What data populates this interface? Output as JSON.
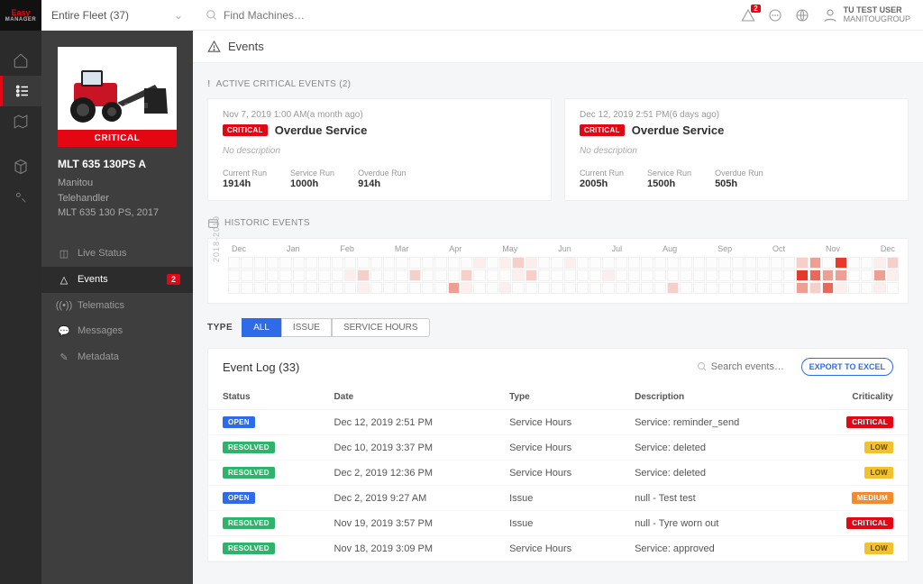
{
  "brand": {
    "name": "Easy",
    "sub": "MANAGER"
  },
  "fleet": {
    "label": "Entire Fleet (37)"
  },
  "topbar": {
    "search_placeholder": "Find Machines…",
    "alert_count": "2"
  },
  "user": {
    "name": "TU TEST USER",
    "org": "MANITOUGROUP"
  },
  "machine": {
    "critical": "CRITICAL",
    "title": "MLT 635 130PS A",
    "brand": "Manitou",
    "type": "Telehandler",
    "model": "MLT 635 130 PS, 2017"
  },
  "nav": {
    "live": "Live Status",
    "events": "Events",
    "events_badge": "2",
    "tele": "Telematics",
    "msg": "Messages",
    "meta": "Metadata"
  },
  "page": {
    "title": "Events",
    "active_label": "ACTIVE CRITICAL EVENTS (2)",
    "historic_label": "HISTORIC EVENTS"
  },
  "events": [
    {
      "time": "Nov 7, 2019 1:00 AM",
      "ago": "(a month ago)",
      "tag": "CRITICAL",
      "title": "Overdue Service",
      "desc": "No description",
      "stats": [
        {
          "l": "Current Run",
          "v": "1914h"
        },
        {
          "l": "Service Run",
          "v": "1000h"
        },
        {
          "l": "Overdue Run",
          "v": "914h"
        }
      ]
    },
    {
      "time": "Dec 12, 2019 2:51 PM",
      "ago": "(6 days ago)",
      "tag": "CRITICAL",
      "title": "Overdue Service",
      "desc": "No description",
      "stats": [
        {
          "l": "Current Run",
          "v": "2005h"
        },
        {
          "l": "Service Run",
          "v": "1500h"
        },
        {
          "l": "Overdue Run",
          "v": "505h"
        }
      ]
    }
  ],
  "months": [
    "Dec",
    "Jan",
    "Feb",
    "Mar",
    "Apr",
    "May",
    "Jun",
    "Jul",
    "Aug",
    "Sep",
    "Oct",
    "Nov",
    "Dec"
  ],
  "ylabel": "2018-2019",
  "tabs": {
    "label": "TYPE",
    "all": "ALL",
    "issue": "ISSUE",
    "sh": "SERVICE HOURS"
  },
  "log": {
    "title": "Event Log (33)",
    "search_placeholder": "Search events…",
    "export": "EXPORT TO EXCEL",
    "cols": {
      "status": "Status",
      "date": "Date",
      "type": "Type",
      "desc": "Description",
      "crit": "Criticality"
    },
    "rows": [
      {
        "status": "OPEN",
        "statusClass": "p-open",
        "date": "Dec 12, 2019 2:51 PM",
        "type": "Service Hours",
        "desc": "Service: reminder_send",
        "crit": "CRITICAL",
        "critClass": "p-crit"
      },
      {
        "status": "RESOLVED",
        "statusClass": "p-resolved",
        "date": "Dec 10, 2019 3:37 PM",
        "type": "Service Hours",
        "desc": "Service: deleted",
        "crit": "LOW",
        "critClass": "p-low"
      },
      {
        "status": "RESOLVED",
        "statusClass": "p-resolved",
        "date": "Dec 2, 2019 12:36 PM",
        "type": "Service Hours",
        "desc": "Service: deleted",
        "crit": "LOW",
        "critClass": "p-low"
      },
      {
        "status": "OPEN",
        "statusClass": "p-open",
        "date": "Dec 2, 2019 9:27 AM",
        "type": "Issue",
        "desc": "null - Test test",
        "crit": "MEDIUM",
        "critClass": "p-med"
      },
      {
        "status": "RESOLVED",
        "statusClass": "p-resolved",
        "date": "Nov 19, 2019 3:57 PM",
        "type": "Issue",
        "desc": "null - Tyre worn out",
        "crit": "CRITICAL",
        "critClass": "p-crit"
      },
      {
        "status": "RESOLVED",
        "statusClass": "p-resolved",
        "date": "Nov 18, 2019 3:09 PM",
        "type": "Service Hours",
        "desc": "Service: approved",
        "crit": "LOW",
        "critClass": "p-low"
      }
    ]
  }
}
